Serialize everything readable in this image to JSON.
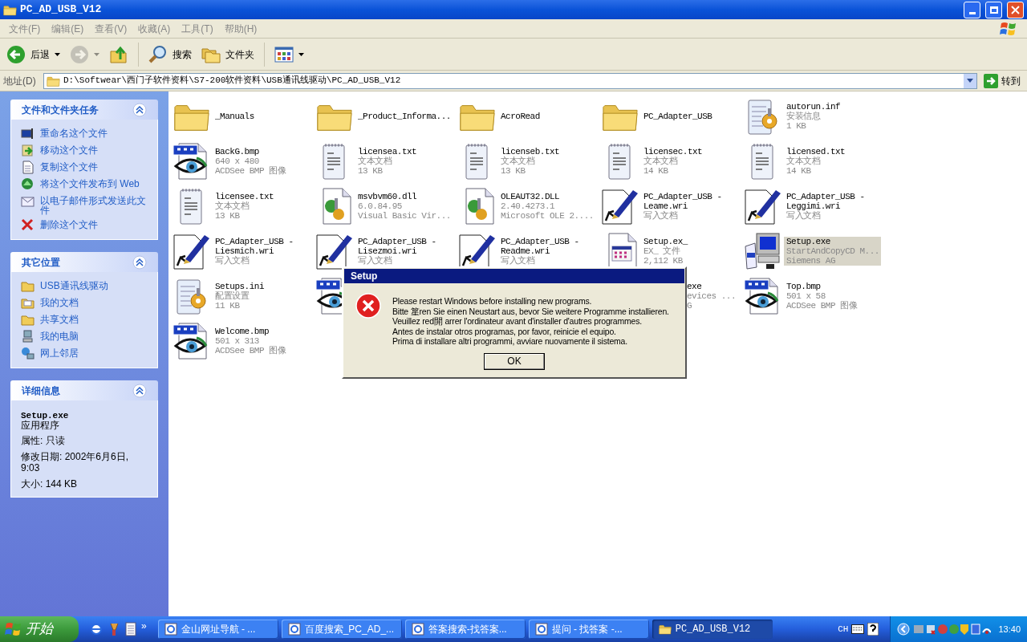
{
  "window": {
    "title": "PC_AD_USB_V12"
  },
  "menu": [
    "文件(F)",
    "编辑(E)",
    "查看(V)",
    "收藏(A)",
    "工具(T)",
    "帮助(H)"
  ],
  "toolbar": [
    {
      "kind": "back",
      "label": "后退",
      "disabled": false
    },
    {
      "kind": "forward",
      "disabled": true
    },
    {
      "kind": "up",
      "disabled": false
    },
    {
      "kind": "search",
      "label": "搜索",
      "disabled": false
    },
    {
      "kind": "folders",
      "label": "文件夹",
      "disabled": false
    },
    {
      "kind": "views",
      "disabled": false
    }
  ],
  "address": {
    "label": "地址(D)",
    "value": "D:\\Softwear\\西门子软件资料\\S7-200软件资料\\USB通讯线驱动\\PC_AD_USB_V12",
    "go": "转到"
  },
  "sidebar": [
    {
      "title": "文件和文件夹任务",
      "expanded": true,
      "items": [
        {
          "kind": "rename",
          "text": "重命名这个文件"
        },
        {
          "kind": "move",
          "text": "移动这个文件"
        },
        {
          "kind": "copy",
          "text": "复制这个文件"
        },
        {
          "kind": "web",
          "text": "将这个文件发布到 Web"
        },
        {
          "kind": "mail",
          "text": "以电子邮件形式发送此文件"
        },
        {
          "kind": "delete",
          "text": "删除这个文件"
        }
      ]
    },
    {
      "title": "其它位置",
      "expanded": true,
      "items": [
        {
          "kind": "folder",
          "text": "USB通讯线驱动"
        },
        {
          "kind": "docs",
          "text": "我的文档"
        },
        {
          "kind": "folder",
          "text": "共享文档"
        },
        {
          "kind": "computer",
          "text": "我的电脑"
        },
        {
          "kind": "network",
          "text": "网上邻居"
        }
      ]
    },
    {
      "title": "详细信息",
      "expanded": true,
      "details": {
        "name": "Setup.exe",
        "type": "应用程序",
        "lines": [
          "属性: 只读",
          "修改日期: 2002年6月6日, 9:03",
          "大小: 144 KB"
        ]
      }
    }
  ],
  "files": [
    {
      "kind": "folder",
      "lines": [
        "_Manuals"
      ],
      "selected": false
    },
    {
      "kind": "folder",
      "lines": [
        "_Product_Informa..."
      ],
      "selected": false
    },
    {
      "kind": "folder",
      "lines": [
        "AcroRead"
      ],
      "selected": false
    },
    {
      "kind": "folder",
      "lines": [
        "PC_Adapter_USB"
      ],
      "selected": false
    },
    {
      "kind": "inf",
      "lines": [
        "autorun.inf",
        "安装信息",
        "1 KB"
      ],
      "selected": false
    },
    {
      "kind": "bmp",
      "lines": [
        "BackG.bmp",
        "640 x 480",
        "ACDSee BMP 图像"
      ],
      "selected": false
    },
    {
      "kind": "txt",
      "lines": [
        "licensea.txt",
        "文本文档",
        "13 KB"
      ],
      "selected": false
    },
    {
      "kind": "txt",
      "lines": [
        "licenseb.txt",
        "文本文档",
        "13 KB"
      ],
      "selected": false
    },
    {
      "kind": "txt",
      "lines": [
        "licensec.txt",
        "文本文档",
        "14 KB"
      ],
      "selected": false
    },
    {
      "kind": "txt",
      "lines": [
        "licensed.txt",
        "文本文档",
        "14 KB"
      ],
      "selected": false
    },
    {
      "kind": "txt",
      "lines": [
        "licensee.txt",
        "文本文档",
        "13 KB"
      ],
      "selected": false
    },
    {
      "kind": "dll",
      "lines": [
        "msvbvm60.dll",
        "6.0.84.95",
        "Visual Basic Vir..."
      ],
      "selected": false
    },
    {
      "kind": "dll",
      "lines": [
        "OLEAUT32.DLL",
        "2.40.4273.1",
        "Microsoft OLE 2...."
      ],
      "selected": false
    },
    {
      "kind": "wri",
      "lines": [
        "PC_Adapter_USB -",
        "Leame.wri",
        "写入文档"
      ],
      "selected": false
    },
    {
      "kind": "wri",
      "lines": [
        "PC_Adapter_USB -",
        "Leggimi.wri",
        "写入文档"
      ],
      "selected": false
    },
    {
      "kind": "wri",
      "lines": [
        "PC_Adapter_USB -",
        "Liesmich.wri",
        "写入文档"
      ],
      "selected": false
    },
    {
      "kind": "wri",
      "lines": [
        "PC_Adapter_USB -",
        "Lisezmoi.wri",
        "写入文档"
      ],
      "selected": false
    },
    {
      "kind": "wri",
      "lines": [
        "PC_Adapter_USB -",
        "Readme.wri",
        "写入文档"
      ],
      "selected": false
    },
    {
      "kind": "exe_",
      "lines": [
        "Setup.ex_",
        "EX_ 文件",
        "2,112 KB"
      ],
      "selected": false
    },
    {
      "kind": "setup",
      "lines": [
        "Setup.exe",
        "StartAndCopyCD M...",
        "Siemens AG"
      ],
      "selected": true
    },
    {
      "kind": "ini",
      "lines": [
        "Setups.ini",
        "配置设置",
        "11 KB"
      ],
      "selected": false
    },
    {
      "kind": "bmp",
      "selected": false
    },
    {
      "kind": "covered",
      "lines": [
        "exe",
        "evices ...",
        "G"
      ],
      "selected": false
    },
    {
      "kind": "bmp",
      "lines": [
        "Top.bmp",
        "501 x 58",
        "ACDSee BMP 图像"
      ],
      "selected": false
    },
    {
      "kind": "bmp",
      "lines": [
        "Welcome.bmp",
        "501 x 313",
        "ACDSee BMP 图像"
      ],
      "selected": false
    }
  ],
  "dialog": {
    "title": "Setup",
    "lines": [
      "Please restart Windows before installing new programs.",
      "Bitte 篂ren Sie einen Neustart aus, bevor Sie weitere Programme installieren.",
      "Veuillez red開 arrer l'ordinateur avant d'installer d'autres programmes.",
      "Antes de instalar otros programas, por favor, reinicie el equipo.",
      "Prima di installare altri programmi, avviare nuovamente il sistema."
    ],
    "button": "OK"
  },
  "taskbar": {
    "start": "开始",
    "more": "»",
    "tasks": [
      {
        "kind": "browser",
        "label": "金山网址导航 - ...",
        "selected": false
      },
      {
        "kind": "browser",
        "label": "百度搜索_PC_AD_...",
        "selected": false
      },
      {
        "kind": "browser",
        "label": "答案搜索-找答案...",
        "selected": false
      },
      {
        "kind": "browser",
        "label": "提问 - 找答案 -...",
        "selected": false
      },
      {
        "kind": "folder",
        "label": "PC_AD_USB_V12",
        "selected": true
      }
    ],
    "language": "CH",
    "clock": "13:40"
  }
}
